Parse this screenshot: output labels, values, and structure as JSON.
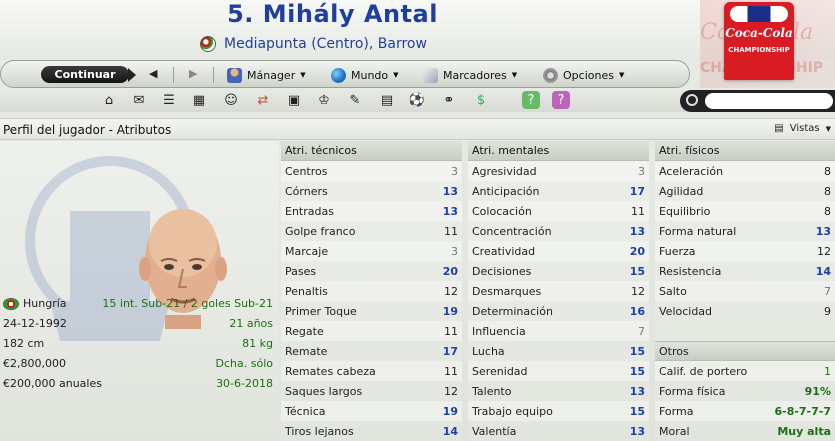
{
  "header": {
    "title": "5. Mihály Antal",
    "subtitle": "Mediapunta (Centro), Barrow",
    "logo_brand": "Coca-Cola",
    "logo_sub": "CHAMPIONSHIP"
  },
  "nav": {
    "continue_label": "Continuar",
    "menus": [
      "Mánager",
      "Mundo",
      "Marcadores",
      "Opciones"
    ]
  },
  "search": {
    "placeholder": ""
  },
  "section": {
    "title": "Perfil del jugador - Atributos",
    "views_label": "Vistas"
  },
  "player": {
    "nationality": "Hungría",
    "caps": "15 int. Sub-21 / 2 goles Sub-21",
    "dob": "24-12-1992",
    "age": "21 años",
    "height": "182 cm",
    "weight": "81 kg",
    "value": "€2,800,000",
    "foot": "Dcha. sólo",
    "wage": "€200,000 anuales",
    "contract_end": "30-6-2018"
  },
  "technical": {
    "header": "Atri. técnicos",
    "rows": [
      {
        "name": "Centros",
        "value": "3"
      },
      {
        "name": "Córners",
        "value": "13"
      },
      {
        "name": "Entradas",
        "value": "13"
      },
      {
        "name": "Golpe franco",
        "value": "11"
      },
      {
        "name": "Marcaje",
        "value": "3"
      },
      {
        "name": "Pases",
        "value": "20"
      },
      {
        "name": "Penaltis",
        "value": "12"
      },
      {
        "name": "Primer Toque",
        "value": "19"
      },
      {
        "name": "Regate",
        "value": "11"
      },
      {
        "name": "Remate",
        "value": "17"
      },
      {
        "name": "Remates cabeza",
        "value": "11"
      },
      {
        "name": "Saques largos",
        "value": "12"
      },
      {
        "name": "Técnica",
        "value": "19"
      },
      {
        "name": "Tiros lejanos",
        "value": "14"
      }
    ]
  },
  "mental": {
    "header": "Atri. mentales",
    "rows": [
      {
        "name": "Agresividad",
        "value": "3"
      },
      {
        "name": "Anticipación",
        "value": "17"
      },
      {
        "name": "Colocación",
        "value": "11"
      },
      {
        "name": "Concentración",
        "value": "13"
      },
      {
        "name": "Creatividad",
        "value": "20"
      },
      {
        "name": "Decisiones",
        "value": "15"
      },
      {
        "name": "Desmarques",
        "value": "12"
      },
      {
        "name": "Determinación",
        "value": "16"
      },
      {
        "name": "Influencia",
        "value": "7"
      },
      {
        "name": "Lucha",
        "value": "15"
      },
      {
        "name": "Serenidad",
        "value": "15"
      },
      {
        "name": "Talento",
        "value": "13"
      },
      {
        "name": "Trabajo equipo",
        "value": "15"
      },
      {
        "name": "Valentía",
        "value": "13"
      }
    ]
  },
  "physical": {
    "header": "Atri. físicos",
    "rows": [
      {
        "name": "Aceleración",
        "value": "8"
      },
      {
        "name": "Agilidad",
        "value": "8"
      },
      {
        "name": "Equilibrio",
        "value": "8"
      },
      {
        "name": "Forma natural",
        "value": "13"
      },
      {
        "name": "Fuerza",
        "value": "12"
      },
      {
        "name": "Resistencia",
        "value": "14"
      },
      {
        "name": "Salto",
        "value": "7"
      },
      {
        "name": "Velocidad",
        "value": "9"
      }
    ]
  },
  "others": {
    "header": "Otros",
    "rows": [
      {
        "name": "Calif. de portero",
        "value": "1"
      },
      {
        "name": "Forma física",
        "value": "91%"
      },
      {
        "name": "Forma",
        "value": "6-8-7-7-7"
      },
      {
        "name": "Moral",
        "value": "Muy alta"
      }
    ]
  }
}
